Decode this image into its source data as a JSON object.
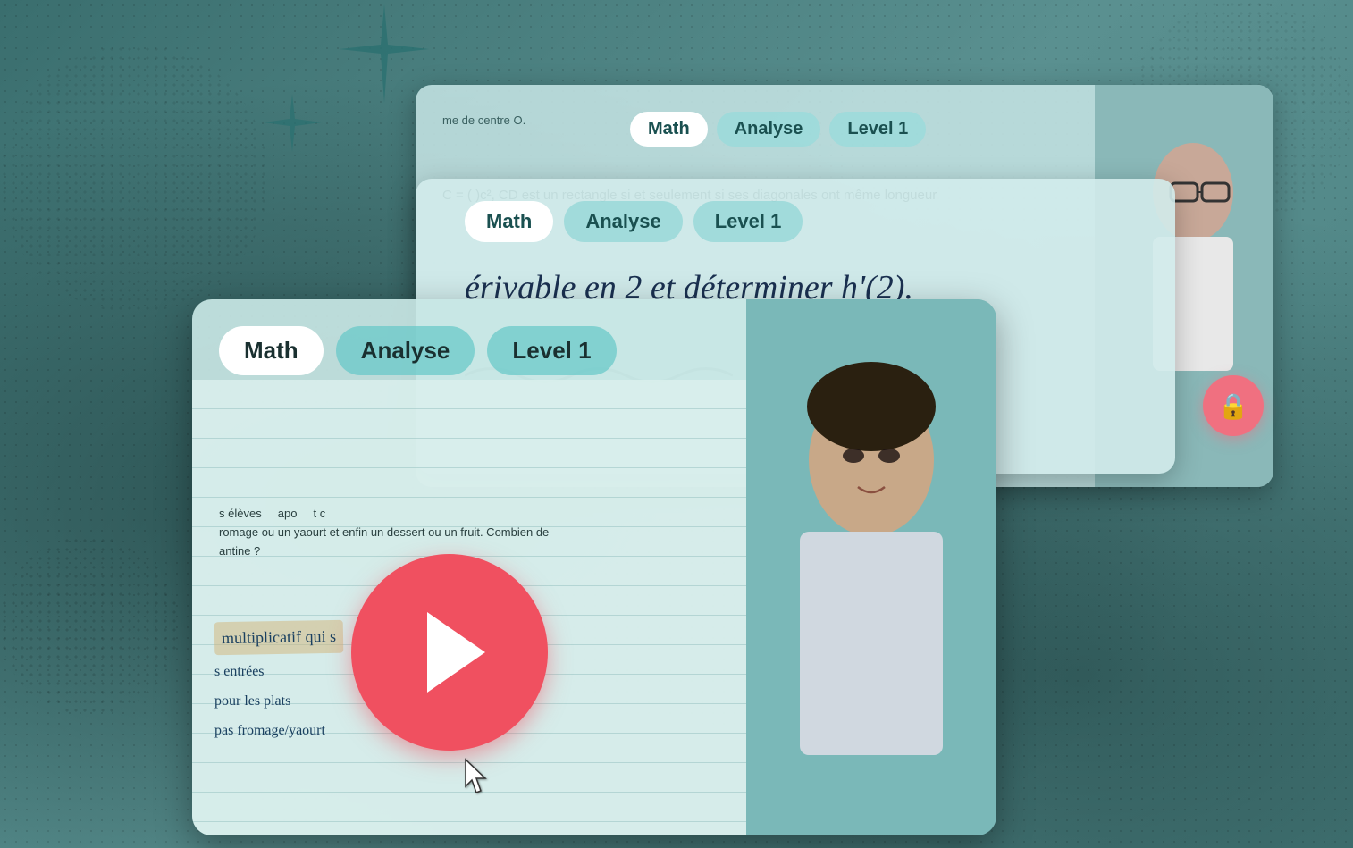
{
  "background": {
    "color": "#4a8080"
  },
  "sparkle1": {
    "symbol": "✦"
  },
  "sparkle2": {
    "symbol": "✦"
  },
  "card_back": {
    "small_text": "me de centre O.",
    "formula": "C = ( )c², CD est un rectangle si et seulement si ses diagonales ont même longueur",
    "tags": {
      "math": "Math",
      "analyse": "Analyse",
      "level": "Level 1"
    }
  },
  "card_mid": {
    "formula": "érivable en 2 et déterminer h'(2).",
    "tags": {
      "math": "Math",
      "analyse": "Analyse",
      "level": "Level 1"
    }
  },
  "card_front": {
    "tags": {
      "math": "Math",
      "analyse": "Analyse",
      "level": "Level 1"
    },
    "problem_text": "s élèves     apo      t c\nromage ou un yaourt et enfin un dessert ou un fruit. Combien de\nantine ?",
    "handwritten": {
      "label": "multiplicatif qui s",
      "line1": "s entrées",
      "line2": "pour les plats",
      "line3": "pas fromage/yaourt"
    }
  },
  "play_button": {
    "label": "Play"
  },
  "lock_button": {
    "label": "Lock"
  },
  "cursor": {
    "symbol": "☞"
  }
}
